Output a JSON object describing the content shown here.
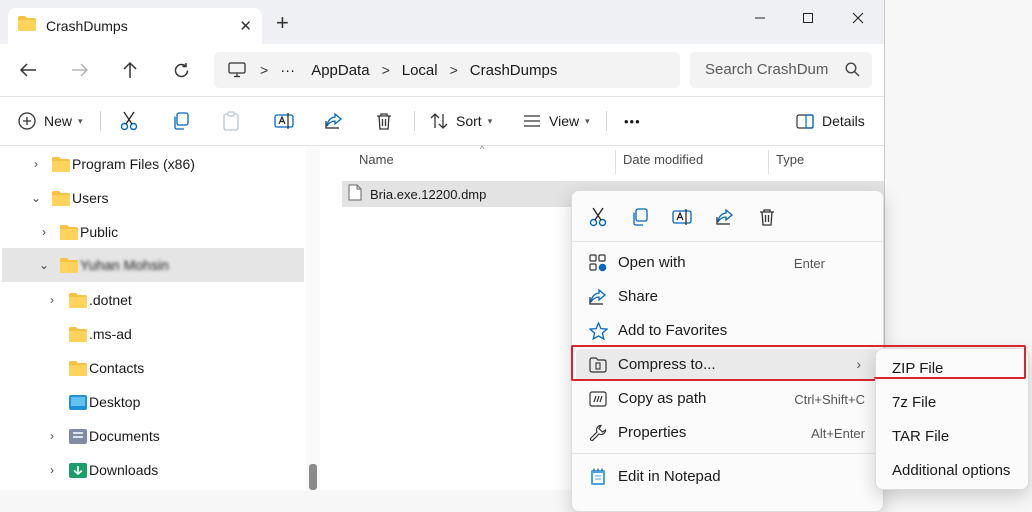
{
  "colors": {
    "accent": "#0067c0",
    "folder": "#f5c242",
    "highlight": "#d9262c"
  },
  "window": {
    "tab_title": "CrashDumps",
    "tab_icon": "folder-icon",
    "new_tab_label": "+",
    "minimize_glyph": "—",
    "maximize_glyph": "☐",
    "close_glyph": "✕",
    "tab_close_glyph": "✕"
  },
  "navigation": {
    "back": "arrow-left-icon",
    "forward": "arrow-right-icon",
    "up": "arrow-up-icon",
    "refresh": "refresh-icon",
    "breadcrumb": {
      "computer_icon": "computer-icon",
      "ellipsis": "···",
      "segments": [
        "AppData",
        "Local",
        "CrashDumps"
      ]
    },
    "search_placeholder": "Search CrashDumps"
  },
  "toolbar": {
    "new_label": "New",
    "sort_label": "Sort",
    "view_label": "View",
    "more_label": "•••",
    "details_label": "Details",
    "icons": [
      "plus-icon",
      "cut-icon",
      "copy-icon",
      "paste-icon",
      "rename-icon",
      "share-icon",
      "delete-icon",
      "sort-icon",
      "view-icon",
      "details-pane-icon"
    ]
  },
  "nav_tree": [
    {
      "label": "Program Files (x86)",
      "expander": "›",
      "icon": "folder"
    },
    {
      "label": "Users",
      "expander": "⌄",
      "icon": "folder"
    },
    {
      "label": "Public",
      "expander": "›",
      "icon": "folder"
    },
    {
      "label": "Yuhan Mohsin",
      "expander": "⌄",
      "icon": "folder",
      "selected": true,
      "obscured": true
    },
    {
      "label": ".dotnet",
      "expander": "›",
      "icon": "folder"
    },
    {
      "label": ".ms-ad",
      "expander": "",
      "icon": "folder"
    },
    {
      "label": "Contacts",
      "expander": "",
      "icon": "folder"
    },
    {
      "label": "Desktop",
      "expander": "",
      "icon": "desktop-folder"
    },
    {
      "label": "Documents",
      "expander": "›",
      "icon": "documents-folder"
    },
    {
      "label": "Downloads",
      "expander": "›",
      "icon": "downloads-folder"
    }
  ],
  "file_list": {
    "columns": [
      "Name",
      "Date modified",
      "Type"
    ],
    "sort_indicator": "^",
    "files": [
      {
        "name": "Bria.exe.12200.dmp",
        "icon": "file-icon"
      }
    ]
  },
  "context_menu": {
    "top_actions": [
      "cut-icon",
      "copy-icon",
      "rename-icon",
      "share-icon",
      "delete-icon"
    ],
    "items": [
      {
        "label": "Open with",
        "shortcut": "Enter",
        "icon": "open-with-icon"
      },
      {
        "label": "Share",
        "shortcut": "",
        "icon": "share-icon"
      },
      {
        "label": "Add to Favorites",
        "shortcut": "",
        "icon": "star-icon"
      },
      {
        "label": "Compress to...",
        "shortcut": "",
        "icon": "compress-icon",
        "submenu": true,
        "active": true
      },
      {
        "label": "Copy as path",
        "shortcut": "Ctrl+Shift+C",
        "icon": "copy-path-icon"
      },
      {
        "label": "Properties",
        "shortcut": "Alt+Enter",
        "icon": "properties-icon"
      },
      {
        "label": "Edit in Notepad",
        "shortcut": "",
        "icon": "notepad-icon"
      }
    ],
    "submenu_arrow": "›"
  },
  "compress_submenu": {
    "items": [
      "ZIP File",
      "7z File",
      "TAR File",
      "Additional options"
    ],
    "highlighted": "ZIP File"
  }
}
